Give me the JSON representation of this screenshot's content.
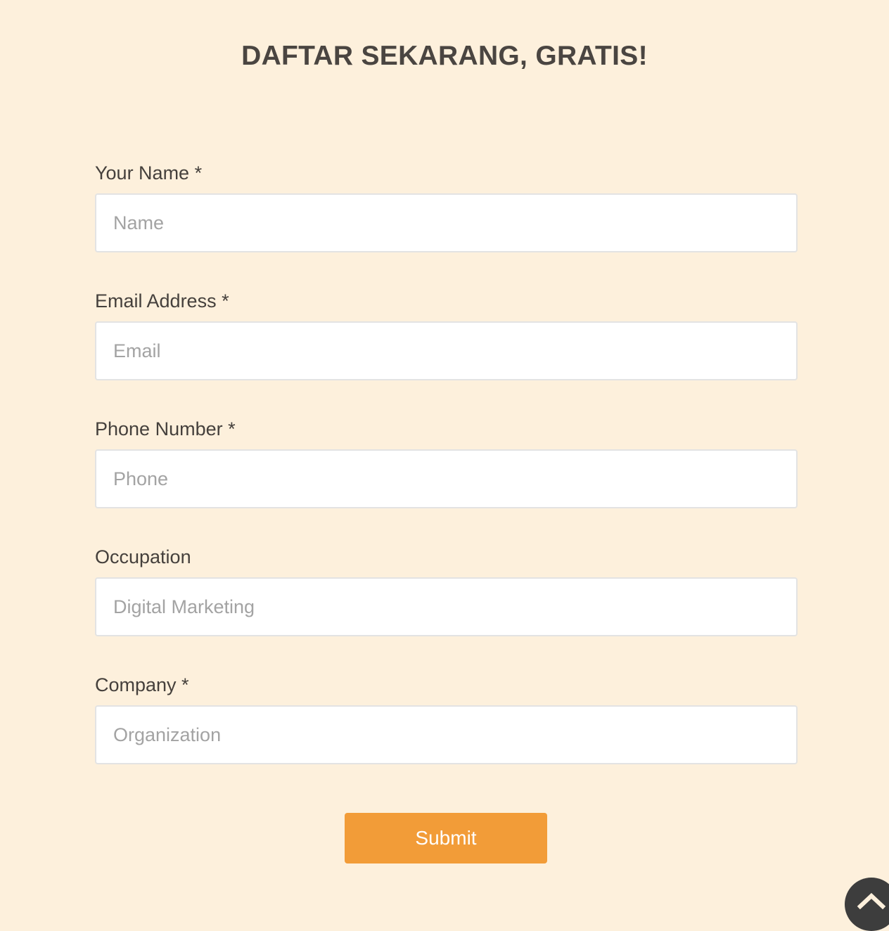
{
  "header": {
    "title": "DAFTAR SEKARANG, GRATIS!"
  },
  "form": {
    "fields": [
      {
        "label": "Your Name *",
        "placeholder": "Name",
        "value": ""
      },
      {
        "label": "Email Address *",
        "placeholder": "Email",
        "value": ""
      },
      {
        "label": "Phone Number *",
        "placeholder": "Phone",
        "value": ""
      },
      {
        "label": "Occupation",
        "placeholder": "Digital Marketing",
        "value": ""
      },
      {
        "label": "Company *",
        "placeholder": "Organization",
        "value": ""
      }
    ],
    "submit_label": "Submit"
  },
  "scroll_top": {
    "icon": "chevron-up-icon"
  },
  "colors": {
    "background": "#fdf0dc",
    "accent": "#f29c38",
    "text": "#4a4541",
    "placeholder": "#a3a3a3",
    "scroll_button": "#3d3d3d"
  }
}
